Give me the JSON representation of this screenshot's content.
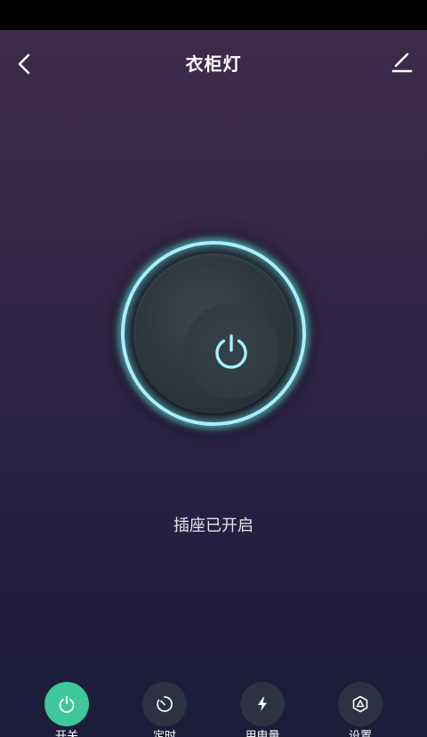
{
  "header": {
    "title": "衣柜灯",
    "back_icon": "chevron-left-icon",
    "edit_icon": "pencil-icon"
  },
  "power": {
    "icon": "power-icon",
    "state": "on",
    "ring_color": "#a8f0fb"
  },
  "status": {
    "text": "插座已开启"
  },
  "tabs": [
    {
      "label": "开关",
      "icon": "power-icon",
      "active": true,
      "color": "#3fc69a"
    },
    {
      "label": "定时",
      "icon": "timer-icon",
      "active": false
    },
    {
      "label": "用电量",
      "icon": "lightning-icon",
      "active": false
    },
    {
      "label": "设置",
      "icon": "settings-hexagon-icon",
      "active": false
    }
  ]
}
